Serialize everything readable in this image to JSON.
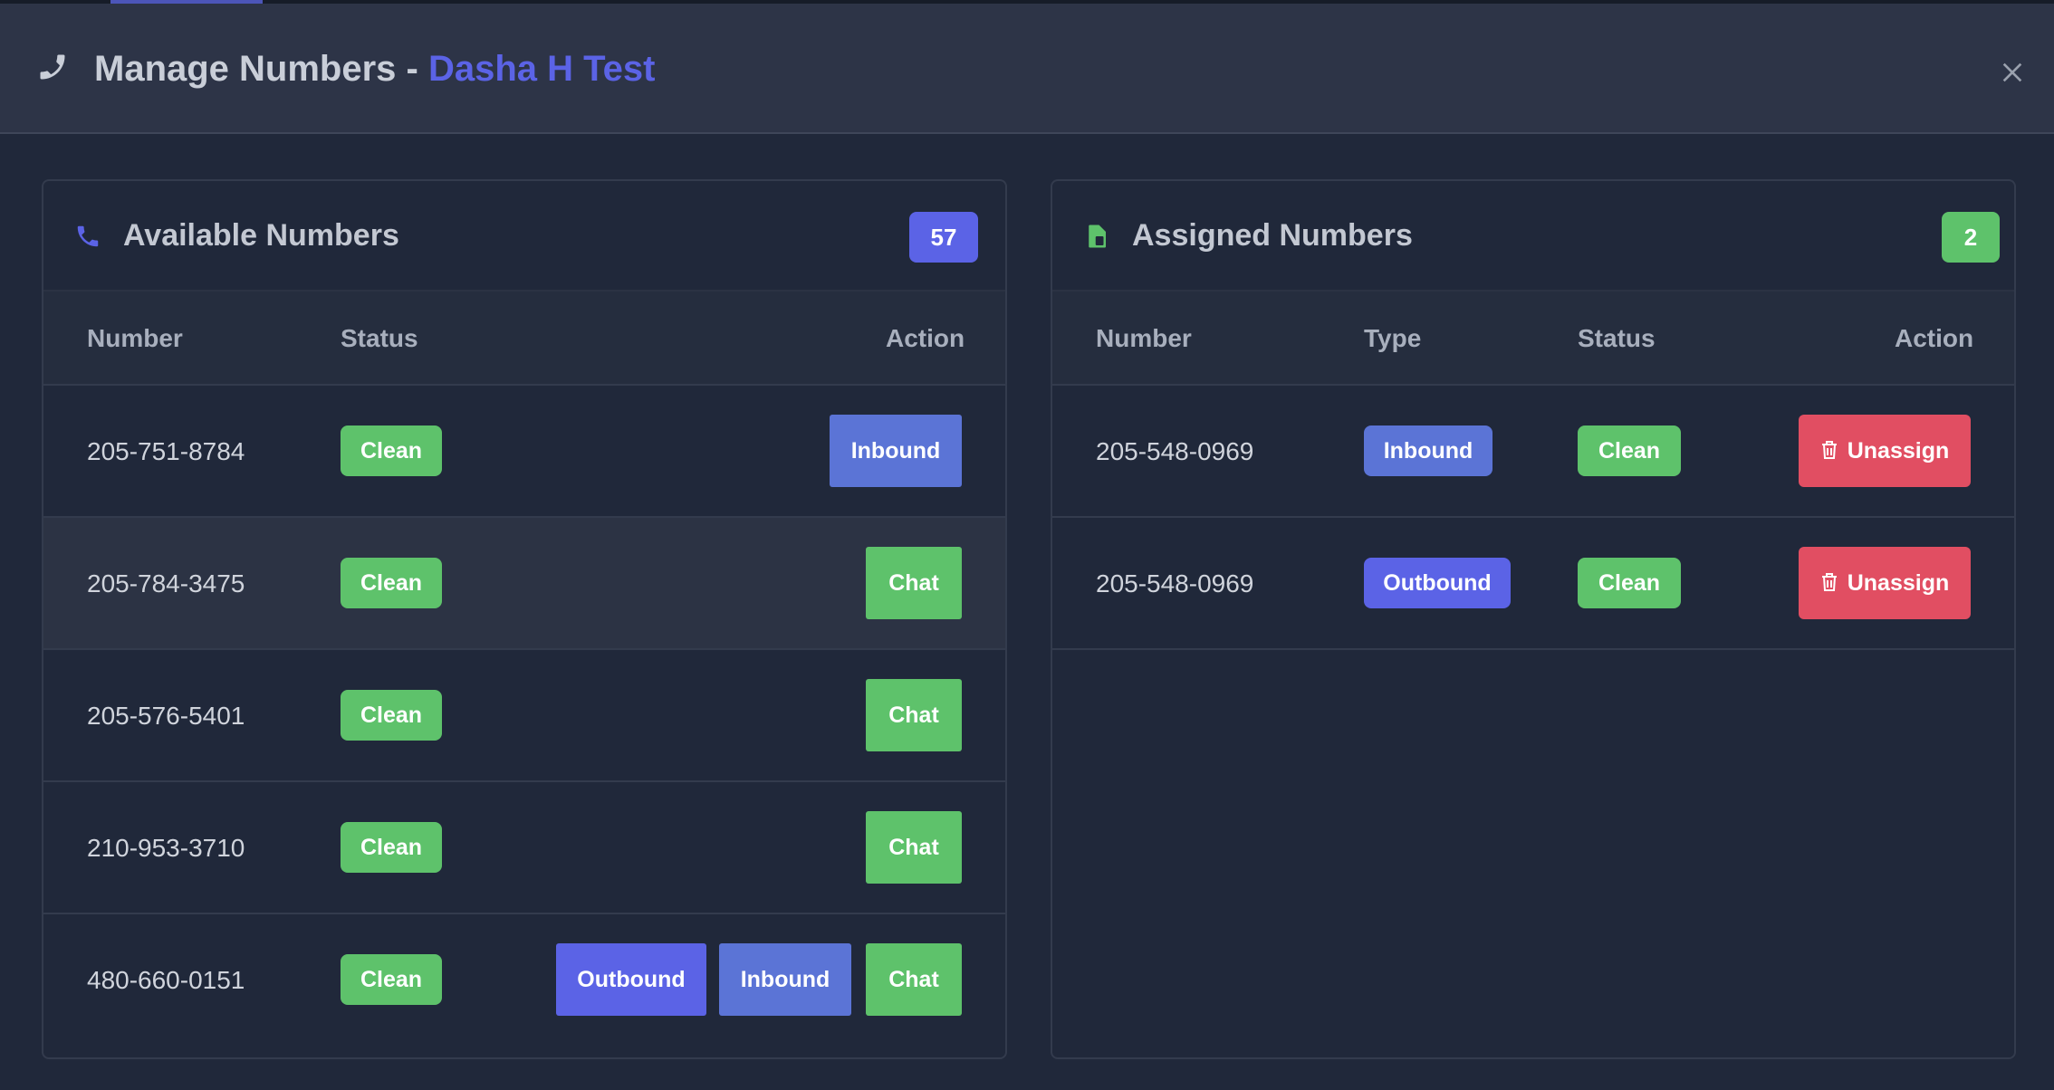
{
  "header": {
    "title_prefix": "Manage Numbers - ",
    "title_accent": "Dasha H Test",
    "icon": "phone-icon",
    "close_icon": "close-icon"
  },
  "available": {
    "title": "Available Numbers",
    "count": "57",
    "icon": "phone-icon",
    "columns": {
      "number": "Number",
      "status": "Status",
      "action": "Action"
    },
    "rows": [
      {
        "number": "205-751-8784",
        "status": "Clean",
        "actions": [
          "Inbound"
        ]
      },
      {
        "number": "205-784-3475",
        "status": "Clean",
        "actions": [
          "Chat"
        ]
      },
      {
        "number": "205-576-5401",
        "status": "Clean",
        "actions": [
          "Chat"
        ]
      },
      {
        "number": "210-953-3710",
        "status": "Clean",
        "actions": [
          "Chat"
        ]
      },
      {
        "number": "480-660-0151",
        "status": "Clean",
        "actions": [
          "Outbound",
          "Inbound",
          "Chat"
        ]
      }
    ]
  },
  "assigned": {
    "title": "Assigned Numbers",
    "count": "2",
    "icon": "sim-card-icon",
    "columns": {
      "number": "Number",
      "type": "Type",
      "status": "Status",
      "action": "Action"
    },
    "rows": [
      {
        "number": "205-548-0969",
        "type": "Inbound",
        "status": "Clean",
        "action": "Unassign"
      },
      {
        "number": "205-548-0969",
        "type": "Outbound",
        "status": "Clean",
        "action": "Unassign"
      }
    ]
  },
  "colors": {
    "accent": "#5b63e6",
    "inbound": "#5b74d6",
    "clean": "#5ec26b",
    "danger": "#e14e62",
    "background": "#20283a"
  }
}
